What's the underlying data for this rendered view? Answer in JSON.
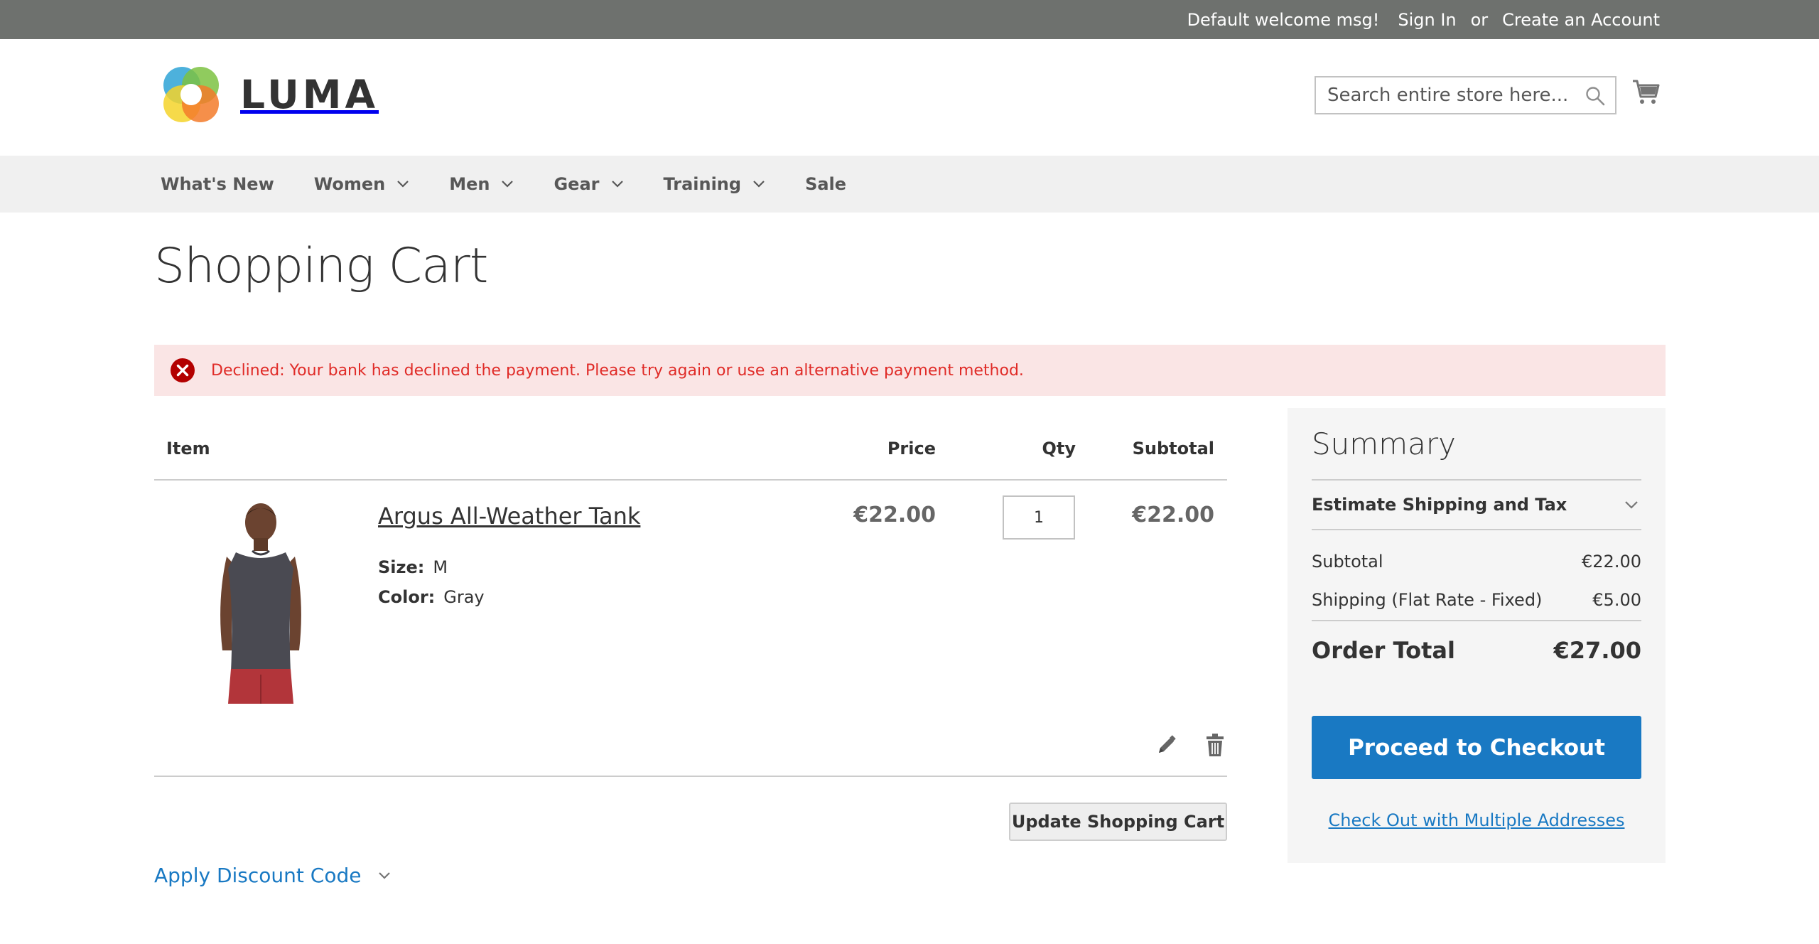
{
  "topbar": {
    "welcome": "Default welcome msg!",
    "sign_in": "Sign In",
    "or": "or",
    "create_account": "Create an Account"
  },
  "header": {
    "logo_text": "LUMA",
    "search_placeholder": "Search entire store here...",
    "search_value": ""
  },
  "nav": {
    "items": [
      {
        "label": "What's New",
        "has_dropdown": false
      },
      {
        "label": "Women",
        "has_dropdown": true
      },
      {
        "label": "Men",
        "has_dropdown": true
      },
      {
        "label": "Gear",
        "has_dropdown": true
      },
      {
        "label": "Training",
        "has_dropdown": true
      },
      {
        "label": "Sale",
        "has_dropdown": false
      }
    ]
  },
  "page": {
    "title": "Shopping Cart"
  },
  "message": {
    "type": "error",
    "text": "Declined: Your bank has declined the payment. Please try again or use an alternative payment method."
  },
  "cart": {
    "headers": {
      "item": "Item",
      "price": "Price",
      "qty": "Qty",
      "subtotal": "Subtotal"
    },
    "items": [
      {
        "name": "Argus All-Weather Tank",
        "options": [
          {
            "label": "Size:",
            "value": "M"
          },
          {
            "label": "Color:",
            "value": "Gray"
          }
        ],
        "price": "€22.00",
        "qty": "1",
        "subtotal": "€22.00"
      }
    ],
    "update_button": "Update Shopping Cart",
    "discount_label": "Apply Discount Code"
  },
  "summary": {
    "title": "Summary",
    "estimate_label": "Estimate Shipping and Tax",
    "subtotal_label": "Subtotal",
    "subtotal_value": "€22.00",
    "shipping_label": "Shipping (Flat Rate - Fixed)",
    "shipping_value": "€5.00",
    "total_label": "Order Total",
    "total_value": "€27.00",
    "checkout_button": "Proceed to Checkout",
    "multi_address_link": "Check Out with Multiple Addresses"
  },
  "colors": {
    "topbar_bg": "#6e716e",
    "nav_bg": "#f0f0f0",
    "error_bg": "#fae5e5",
    "error_text": "#e02b27",
    "primary_blue": "#1979c3",
    "summary_bg": "#f5f5f5"
  },
  "icons": {
    "search": "search-icon",
    "cart": "cart-icon",
    "error": "error-icon",
    "edit": "pencil-icon",
    "delete": "trash-icon",
    "dropdown": "chevron-down-icon"
  }
}
